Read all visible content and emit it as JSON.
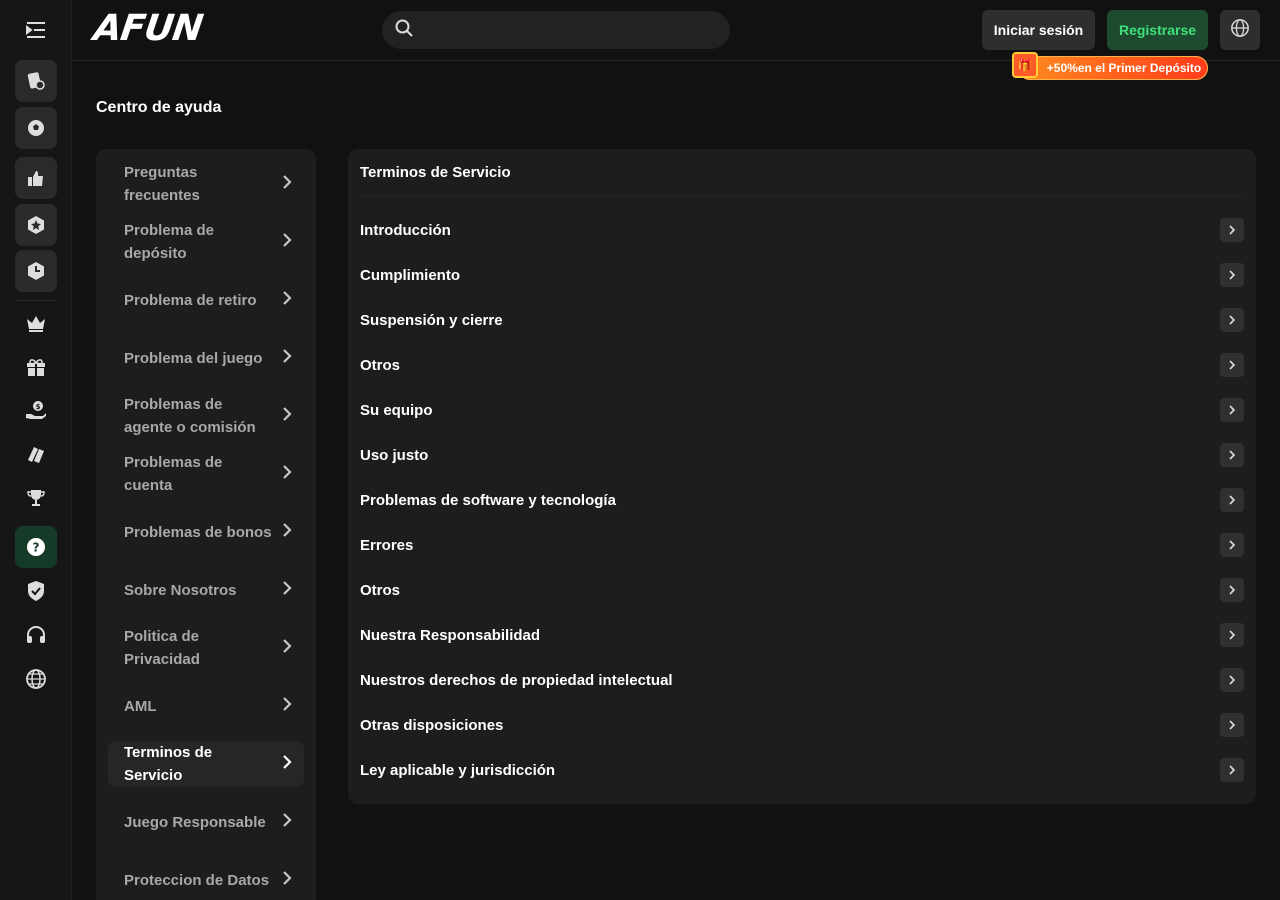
{
  "header": {
    "logo": "AFUN",
    "search": {
      "placeholder": ""
    },
    "login_label": "Iniciar sesión",
    "register_label": "Registrarse",
    "promo_text": "+50%en el Primer Depósito"
  },
  "rail": {
    "top_icons": [
      "casino-cards-icon",
      "soccer-ball-icon",
      "thumbs-up-icon",
      "star-badge-icon",
      "clock-icon"
    ],
    "bottom_icons": [
      "crown-icon",
      "gift-icon",
      "money-hand-icon",
      "tickets-icon",
      "trophy-icon",
      "help-icon",
      "shield-check-icon",
      "headset-icon",
      "globe-icon"
    ],
    "active": "help-icon"
  },
  "page": {
    "title": "Centro de ayuda"
  },
  "help_menu": {
    "items": [
      {
        "label": "Preguntas frecuentes"
      },
      {
        "label": "Problema de depósito"
      },
      {
        "label": "Problema de retiro"
      },
      {
        "label": "Problema del juego"
      },
      {
        "label": "Problemas de agente o comisión"
      },
      {
        "label": "Problemas de cuenta"
      },
      {
        "label": "Problemas de bonos"
      },
      {
        "label": "Sobre Nosotros"
      },
      {
        "label": "Politica de Privacidad"
      },
      {
        "label": "AML"
      },
      {
        "label": "Terminos de Servicio"
      },
      {
        "label": "Juego Responsable"
      },
      {
        "label": "Proteccion de Datos"
      }
    ],
    "active_index": 10
  },
  "content": {
    "title": "Terminos de Servicio",
    "sections": [
      {
        "label": "Introducción"
      },
      {
        "label": "Cumplimiento"
      },
      {
        "label": "Suspensión y cierre"
      },
      {
        "label": "Otros"
      },
      {
        "label": "Su equipo"
      },
      {
        "label": "Uso justo"
      },
      {
        "label": "Problemas de software y tecnología"
      },
      {
        "label": "Errores"
      },
      {
        "label": "Otros"
      },
      {
        "label": "Nuestra Responsabilidad"
      },
      {
        "label": "Nuestros derechos de propiedad intelectual"
      },
      {
        "label": "Otras disposiciones"
      },
      {
        "label": "Ley aplicable y jurisdicción"
      }
    ]
  },
  "colors": {
    "background": "#111111",
    "panel": "#1d1d1d",
    "accent_green": "#3ee07a",
    "register_bg": "#1e4a2f",
    "promo_orange": "#ff5a1e"
  }
}
